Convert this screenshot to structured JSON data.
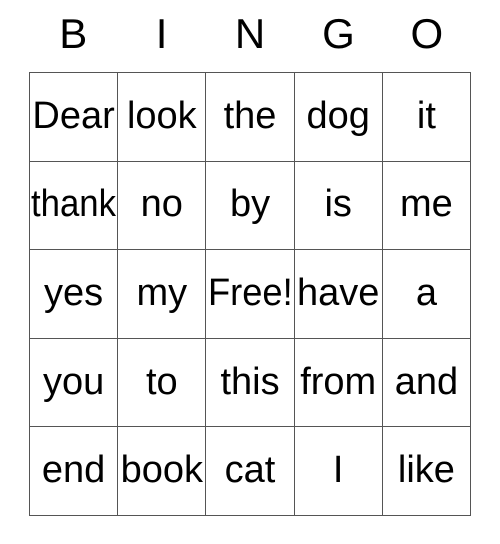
{
  "card": {
    "headers": [
      "B",
      "I",
      "N",
      "G",
      "O"
    ],
    "rows": [
      [
        "Dear",
        "look",
        "the",
        "dog",
        "it"
      ],
      [
        "thank",
        "no",
        "by",
        "is",
        "me"
      ],
      [
        "yes",
        "my",
        "Free!",
        "have",
        "a"
      ],
      [
        "you",
        "to",
        "this",
        "from",
        "and"
      ],
      [
        "end",
        "book",
        "cat",
        "I",
        "like"
      ]
    ],
    "free_space": "Free!",
    "colors": {
      "text": "#000000",
      "border": "#555555",
      "background": "#ffffff"
    }
  }
}
